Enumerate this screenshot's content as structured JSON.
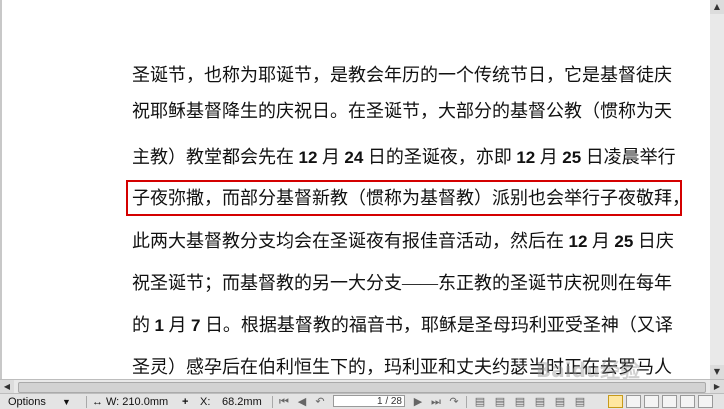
{
  "document": {
    "lines": [
      {
        "parts": [
          {
            "t": "圣诞节，也称为耶诞节，是教会年历的一个传统节日，它是基督徒庆"
          }
        ]
      },
      {
        "parts": [
          {
            "t": "祝耶稣基督降生的庆祝日。在圣诞节，大部分的基督公教（惯称为天"
          }
        ]
      },
      {
        "parts": [
          {
            "t": "主教）教堂都会先在 "
          },
          {
            "t": "12",
            "b": true
          },
          {
            "t": " 月 "
          },
          {
            "t": "24",
            "b": true
          },
          {
            "t": " 日的圣诞夜，亦即 "
          },
          {
            "t": "12",
            "b": true
          },
          {
            "t": " 月 "
          },
          {
            "t": "25",
            "b": true
          },
          {
            "t": " 日凌晨举行"
          }
        ]
      },
      {
        "parts": [
          {
            "t": "子夜弥撒，而部分基督新教（惯称为基督教）派别也会举行子夜敬拜，"
          }
        ]
      },
      {
        "parts": [
          {
            "t": "此两大基督教分支均会在圣诞夜有报佳音活动，然后在 "
          },
          {
            "t": "12",
            "b": true
          },
          {
            "t": " 月 "
          },
          {
            "t": "25",
            "b": true
          },
          {
            "t": " 日庆"
          }
        ]
      },
      {
        "parts": [
          {
            "t": "祝圣诞节；而基督教的另一大分支——东正教的圣诞节庆祝则在每年"
          }
        ]
      },
      {
        "parts": [
          {
            "t": "的 "
          },
          {
            "t": "1",
            "b": true
          },
          {
            "t": " 月 "
          },
          {
            "t": "7",
            "b": true
          },
          {
            "t": " 日。根据基督教的福音书，耶稣是圣母玛利亚受圣神（又译"
          }
        ]
      },
      {
        "parts": [
          {
            "t": "圣灵）感孕后在伯利恒生下的，玛利亚和丈夫约瑟当时正在去罗马人"
          }
        ]
      }
    ]
  },
  "statusbar": {
    "options_label": "Options",
    "width_label": "W: 210.0mm",
    "x_label": "X:",
    "x_value": "68.2mm",
    "page_current": "1",
    "page_total": "/ 28"
  },
  "watermark": "Baidu经验",
  "colors": {
    "highlight": "#d40000",
    "page": "#ffffff",
    "chrome": "#e4e4e4"
  }
}
